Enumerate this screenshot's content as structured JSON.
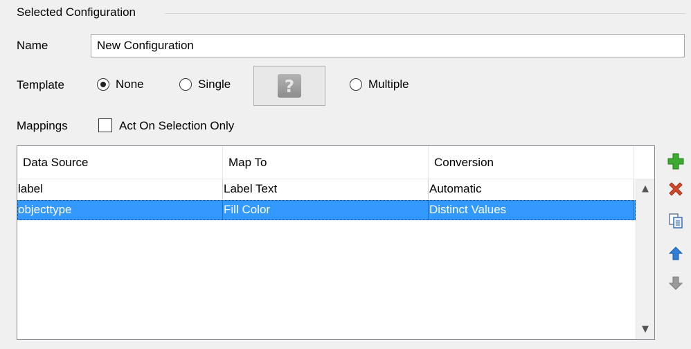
{
  "group": {
    "title": "Selected Configuration"
  },
  "name": {
    "label": "Name",
    "value": "New Configuration"
  },
  "template": {
    "label": "Template",
    "options": [
      {
        "label": "None",
        "selected": true
      },
      {
        "label": "Single",
        "selected": false
      },
      {
        "label": "Multiple",
        "selected": false
      }
    ],
    "template_button_icon": "question-mark-icon"
  },
  "mappings": {
    "label": "Mappings",
    "checkbox_label": "Act On Selection Only",
    "checked": false
  },
  "table": {
    "columns": [
      "Data Source",
      "Map To",
      "Conversion"
    ],
    "rows": [
      {
        "data_source": "label",
        "map_to": "Label Text",
        "conversion": "Automatic",
        "selected": false
      },
      {
        "data_source": "objecttype",
        "map_to": "Fill Color",
        "conversion": "Distinct Values",
        "selected": true
      }
    ]
  },
  "toolbar": {
    "icons": [
      "add-icon",
      "delete-icon",
      "copy-icon",
      "move-up-icon",
      "move-down-icon"
    ]
  },
  "colors": {
    "selection": "#3399ff",
    "add": "#3cab2f",
    "delete": "#d24a2a",
    "arrow": "#2f7fd6"
  }
}
